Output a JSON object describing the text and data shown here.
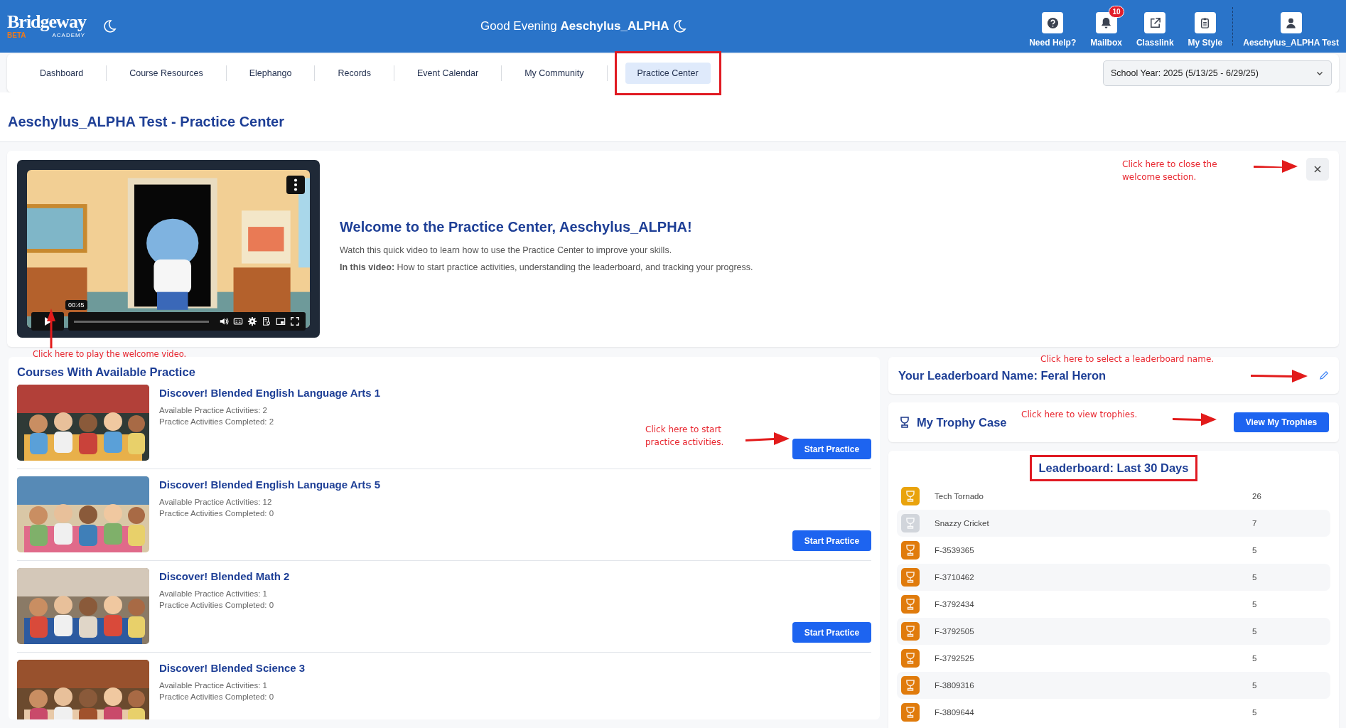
{
  "header": {
    "logo": {
      "wordmark": "Bridgeway",
      "tag": "BETA",
      "subtitle": "ACADEMY"
    },
    "greeting": "Good Evening **Aeschylus_ALPHA**",
    "actions": [
      {
        "label": "Need Help?"
      },
      {
        "label": "Mailbox",
        "badge": "10"
      },
      {
        "label": "Classlink"
      },
      {
        "label": "My Style"
      }
    ],
    "profile": {
      "label": "Aeschylus_ALPHA Test"
    }
  },
  "nav": {
    "tabs": [
      {
        "label": "Dashboard",
        "selected": false,
        "highlighted": false
      },
      {
        "label": "Course Resources",
        "selected": false,
        "highlighted": false
      },
      {
        "label": "Elephango",
        "selected": false,
        "highlighted": false
      },
      {
        "label": "Records",
        "selected": false,
        "highlighted": false
      },
      {
        "label": "Event Calendar",
        "selected": false,
        "highlighted": false
      },
      {
        "label": "My Community",
        "selected": false,
        "highlighted": false
      },
      {
        "label": "Practice Center",
        "selected": true,
        "highlighted": true
      }
    ],
    "school_year": {
      "value": "School Year: 2025 (5/13/25 - 6/29/25)"
    }
  },
  "page_title": "Aeschylus_ALPHA Test - Practice Center",
  "welcome": {
    "video": {
      "time": "00:45",
      "annotation": "Click here to play the welcome video."
    },
    "heading": "Welcome to the Practice Center, Aeschylus_ALPHA!",
    "text": "Watch this quick video to learn how to use the Practice Center to improve your skills.",
    "detail": "**In this video:** How to start practice activities, understanding the leaderboard, and tracking your progress.",
    "close_annotation": "Click here to close the welcome section."
  },
  "courses": {
    "heading": "Courses With Available Practice",
    "annotation": "Click here to start practice activities.",
    "items": [
      {
        "title": "Discover! Blended English Language Arts 1",
        "available": "Available Practice Activities: 2",
        "completed": "Practice Activities Completed: 2",
        "button": "Start Practice"
      },
      {
        "title": "Discover! Blended English Language Arts 5",
        "available": "Available Practice Activities: 12",
        "completed": "Practice Activities Completed: 0",
        "button": "Start Practice"
      },
      {
        "title": "Discover! Blended Math 2",
        "available": "Available Practice Activities: 1",
        "completed": "Practice Activities Completed: 0",
        "button": "Start Practice"
      },
      {
        "title": "Discover! Blended Science 3",
        "available": "Available Practice Activities: 1",
        "completed": "Practice Activities Completed: 0"
      }
    ]
  },
  "leaderboard_name": {
    "text": "Your Leaderboard Name: Feral Heron",
    "annotation": "Click here to select a leaderboard name."
  },
  "trophy_case": {
    "title": "My Trophy Case",
    "annotation": "Click here to view trophies.",
    "button": "View My Trophies"
  },
  "leaderboard": {
    "title": "Leaderboard: Last 30 Days",
    "highlighted": true,
    "entries": [
      {
        "name": "Tech Tornado",
        "score": "26",
        "color": "#e9a30c"
      },
      {
        "name": "Snazzy Cricket",
        "score": "7",
        "color": "#d1d5db"
      },
      {
        "name": "F-3539365",
        "score": "5",
        "color": "#e07b0c"
      },
      {
        "name": "F-3710462",
        "score": "5",
        "color": "#e07b0c"
      },
      {
        "name": "F-3792434",
        "score": "5",
        "color": "#e07b0c"
      },
      {
        "name": "F-3792505",
        "score": "5",
        "color": "#e07b0c"
      },
      {
        "name": "F-3792525",
        "score": "5",
        "color": "#e07b0c"
      },
      {
        "name": "F-3809316",
        "score": "5",
        "color": "#e07b0c"
      },
      {
        "name": "F-3809644",
        "score": "5",
        "color": "#e07b0c"
      }
    ]
  }
}
